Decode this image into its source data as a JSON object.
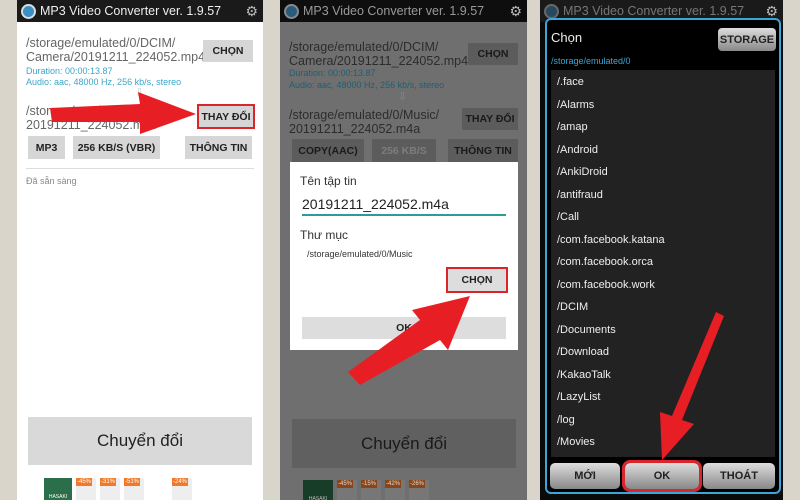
{
  "app_title": "MP3 Video Converter ver. 1.9.57",
  "icons": {
    "gear": "gear-icon",
    "logo": "app-logo-icon",
    "down": "down-arrow-icon"
  },
  "colors": {
    "highlight": "#d9262c",
    "info": "#3aa6c9",
    "dialog_border": "#3aa6d9"
  },
  "panel1": {
    "input_path": "/storage/emulated/0/DCIM/ Camera/20191211_224052.mp4",
    "duration": "Duration: 00:00:13.87",
    "audio": "Audio: aac, 48000 Hz, 256 kb/s, stereo",
    "choose": "CHỌN",
    "output_path": "/storage/emulated/0/ 20191211_224052.mp3",
    "change": "THAY ĐỔI",
    "format": "MP3",
    "bitrate": "256 KB/S (VBR)",
    "info": "THÔNG TIN",
    "status": "Đã sẵn sàng",
    "convert": "Chuyển đổi",
    "ad": {
      "brand": "HASAKI",
      "discounts": [
        "-45%",
        "-31%",
        "-51%",
        "",
        "-24%"
      ]
    }
  },
  "panel2": {
    "input_path": "/storage/emulated/0/DCIM/ Camera/20191211_224052.mp4",
    "duration": "Duration: 00:00:13.87",
    "audio": "Audio: aac, 48000 Hz, 256 kb/s, stereo",
    "choose": "CHỌN",
    "output_path": "/storage/emulated/0/Music/ 20191211_224052.m4a",
    "change": "THAY ĐỔI",
    "format": "COPY(AAC)",
    "bitrate": "256 KB/S",
    "info": "THÔNG TIN",
    "convert": "Chuyển đổi",
    "ad": {
      "brand": "HASAKI",
      "discounts": [
        "-45%",
        "-15%",
        "-42%",
        "-26%"
      ]
    },
    "dialog": {
      "filename_label": "Tên tập tin",
      "filename_value": "20191211_224052.m4a",
      "folder_label": "Thư mục",
      "folder_value": "/storage/emulated/0/Music",
      "choose": "CHỌN",
      "ok": "OK"
    }
  },
  "panel3": {
    "dialog": {
      "title": "Chọn",
      "storage": "STORAGE",
      "current_path": "/storage/emulated/0",
      "items": [
        "/.face",
        "/Alarms",
        "/amap",
        "/Android",
        "/AnkiDroid",
        "/antifraud",
        "/Call",
        "/com.facebook.katana",
        "/com.facebook.orca",
        "/com.facebook.work",
        "/DCIM",
        "/Documents",
        "/Download",
        "/KakaoTalk",
        "/LazyList",
        "/log",
        "/Movies"
      ],
      "new": "MỚI",
      "ok": "OK",
      "exit": "THOÁT"
    }
  }
}
